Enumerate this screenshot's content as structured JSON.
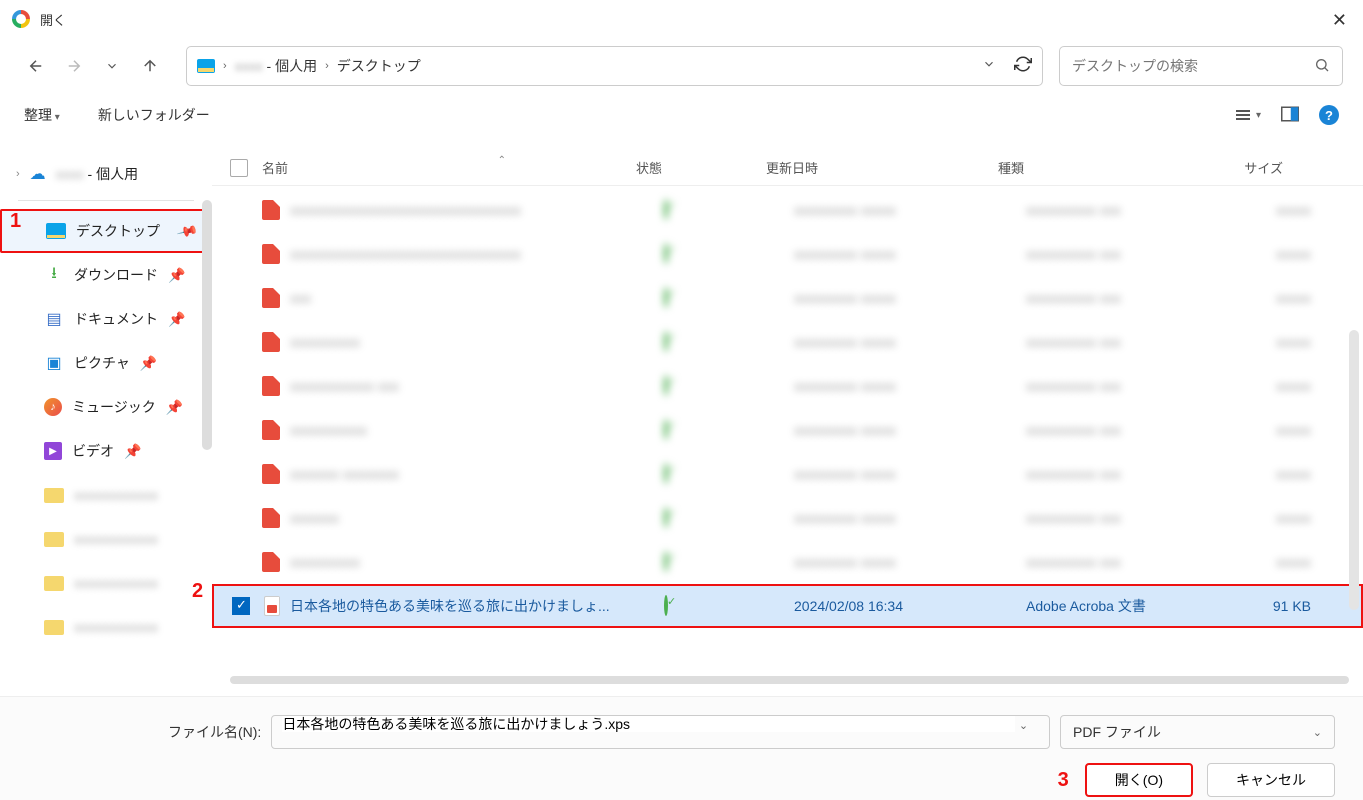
{
  "titlebar": {
    "title": "開く"
  },
  "nav": {
    "back": "←",
    "forward": "→",
    "recent": "⌄",
    "up": "↑"
  },
  "address": {
    "user_blur": "xxxx",
    "personal": " - 個人用",
    "crumb2": "デスクトップ"
  },
  "search": {
    "placeholder": "デスクトップの検索"
  },
  "toolbar": {
    "organize": "整理",
    "newfolder": "新しいフォルダー"
  },
  "tree": {
    "top_personal": " - 個人用",
    "quick": [
      {
        "icon": "monitor",
        "label": "デスクトップ",
        "selected": true
      },
      {
        "icon": "dl",
        "label": "ダウンロード"
      },
      {
        "icon": "doc",
        "label": "ドキュメント"
      },
      {
        "icon": "pic",
        "label": "ピクチャ"
      },
      {
        "icon": "music",
        "label": "ミュージック"
      },
      {
        "icon": "video",
        "label": "ビデオ"
      }
    ]
  },
  "columns": {
    "name": "名前",
    "state": "状態",
    "date": "更新日時",
    "type": "種類",
    "size": "サイズ"
  },
  "selected_file": {
    "name": "日本各地の特色ある美味を巡る旅に出かけましょ...",
    "date": "2024/02/08 16:34",
    "type": "Adobe Acroba 文書",
    "size": "91 KB"
  },
  "filename": {
    "label": "ファイル名(N):",
    "value": "日本各地の特色ある美味を巡る旅に出かけましょう.xps"
  },
  "filetype": {
    "label": "PDF ファイル"
  },
  "buttons": {
    "open": "開く(O)",
    "cancel": "キャンセル"
  },
  "callouts": {
    "one": "1",
    "two": "2",
    "three": "3"
  }
}
